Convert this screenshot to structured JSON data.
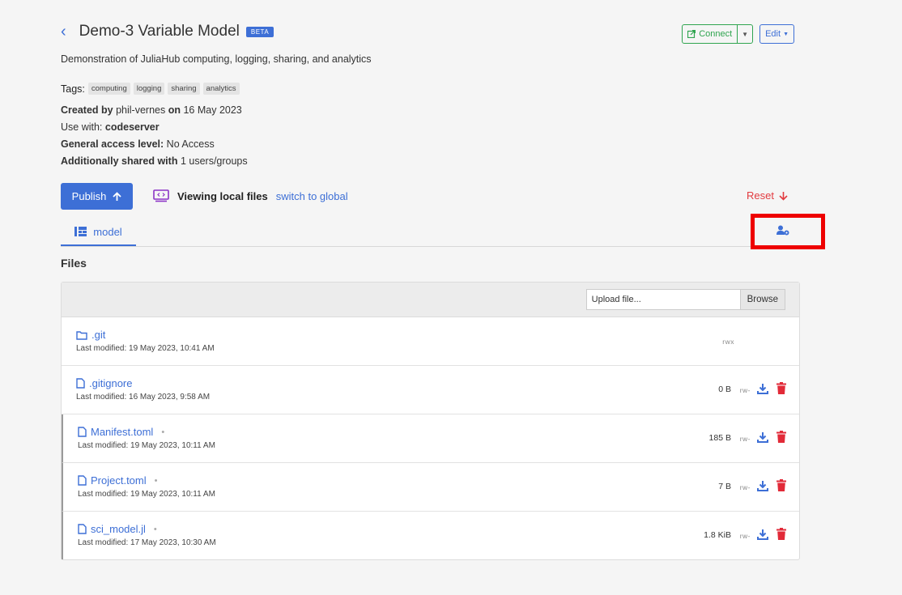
{
  "header": {
    "title": "Demo-3 Variable Model",
    "badge": "BETA",
    "connect_label": "Connect",
    "edit_label": "Edit"
  },
  "description": "Demonstration of JuliaHub computing, logging, sharing, and analytics",
  "tags": {
    "label": "Tags",
    "items": [
      "computing",
      "logging",
      "sharing",
      "analytics"
    ]
  },
  "meta": {
    "created_by_label": "Created by",
    "created_by": "phil-vernes",
    "created_on_label": "on",
    "created_on": "16 May 2023",
    "use_with_label": "Use with:",
    "use_with": "codeserver",
    "access_label": "General access level:",
    "access": "No Access",
    "shared_label": "Additionally shared with",
    "shared": "1 users/groups"
  },
  "actions": {
    "publish_label": "Publish",
    "viewing_label": "Viewing local files",
    "switch_label": "switch to global",
    "reset_label": "Reset"
  },
  "tabs": {
    "model_label": "model"
  },
  "files": {
    "heading": "Files",
    "upload_placeholder": "Upload file...",
    "browse_label": "Browse",
    "rows": [
      {
        "name": ".git",
        "modified": "Last modified: 19 May 2023, 10:41 AM",
        "size": "",
        "perm": "rwx",
        "type": "folder",
        "changed": false
      },
      {
        "name": ".gitignore",
        "modified": "Last modified: 16 May 2023, 9:58 AM",
        "size": "0 B",
        "perm": "rw-",
        "type": "file",
        "changed": false
      },
      {
        "name": "Manifest.toml",
        "modified": "Last modified: 19 May 2023, 10:11 AM",
        "size": "185 B",
        "perm": "rw-",
        "type": "file",
        "changed": true
      },
      {
        "name": "Project.toml",
        "modified": "Last modified: 19 May 2023, 10:11 AM",
        "size": "7 B",
        "perm": "rw-",
        "type": "file",
        "changed": true
      },
      {
        "name": "sci_model.jl",
        "modified": "Last modified: 17 May 2023, 10:30 AM",
        "size": "1.8 KiB",
        "perm": "rw-",
        "type": "file",
        "changed": true
      }
    ]
  },
  "colors": {
    "accent": "#3d6fd6",
    "success": "#2fa44f",
    "danger": "#e23b40",
    "highlight": "#ee0000",
    "background": "#f5f5f5"
  },
  "icons": [
    "chevron-left-icon",
    "external-link-icon",
    "caret-down-icon",
    "arrow-up-icon",
    "code-window-icon",
    "arrow-down-icon",
    "tree-icon",
    "user-lock-icon",
    "folder-icon",
    "file-icon",
    "download-icon",
    "trash-icon"
  ]
}
